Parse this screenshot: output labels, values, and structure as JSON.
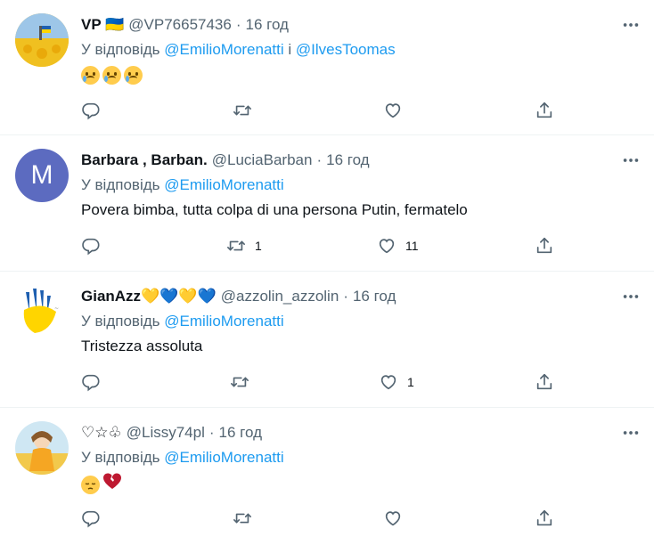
{
  "tweets": [
    {
      "name": "VP 🇺🇦",
      "handle": "@VP76657436",
      "time": "16 год",
      "reply_prefix": "У відповідь",
      "mention1": "@EmilioMorenatti",
      "reply_join": "і",
      "mention2": "@IlvesToomas",
      "text": "",
      "retweets": "",
      "likes": ""
    },
    {
      "name": "Barbara , Barban.",
      "handle": "@LuciaBarban",
      "time": "16 год",
      "reply_prefix": "У відповідь",
      "mention1": "@EmilioMorenatti",
      "text": "Povera bimba, tutta colpa di una persona Putin, fermatelo",
      "avatar_letter": "M",
      "retweets": "1",
      "likes": "11"
    },
    {
      "name": "GianAzz💛💙💛💙",
      "handle": "@azzolin_azzolin",
      "time": "16 год",
      "reply_prefix": "У відповідь",
      "mention1": "@EmilioMorenatti",
      "text": "Tristezza assoluta",
      "retweets": "",
      "likes": "1"
    },
    {
      "name": "♡☆♧",
      "handle": "@Lissy74pl",
      "time": "16 год",
      "reply_prefix": "У відповідь",
      "mention1": "@EmilioMorenatti",
      "text": "",
      "retweets": "",
      "likes": ""
    }
  ],
  "icons": {
    "more": "more-icon",
    "reply": "reply-icon",
    "retweet": "retweet-icon",
    "like": "like-icon",
    "share": "share-icon"
  },
  "colors": {
    "accent": "#1d9bf0",
    "secondary_text": "#536471",
    "avatar_purple": "#5c6bc0"
  }
}
